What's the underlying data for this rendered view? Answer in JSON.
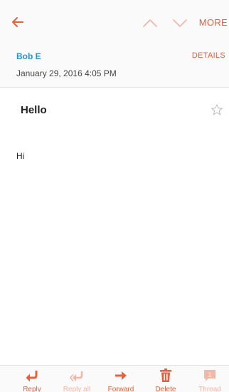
{
  "topbar": {
    "more_label": "MORE"
  },
  "message": {
    "sender": "Bob E",
    "details_label": "DETAILS",
    "date": "January 29, 2016  4:05 PM",
    "subject": "Hello",
    "body": "Hi"
  },
  "toolbar": {
    "reply_label": "Reply",
    "reply_all_label": "Reply all",
    "forward_label": "Forward",
    "delete_label": "Delete",
    "thread_label": "Thread",
    "thread_count": "1"
  },
  "colors": {
    "accent": "#e8603e",
    "accent_disabled": "#f3b7a8",
    "sender_blue": "#2a93c8"
  }
}
